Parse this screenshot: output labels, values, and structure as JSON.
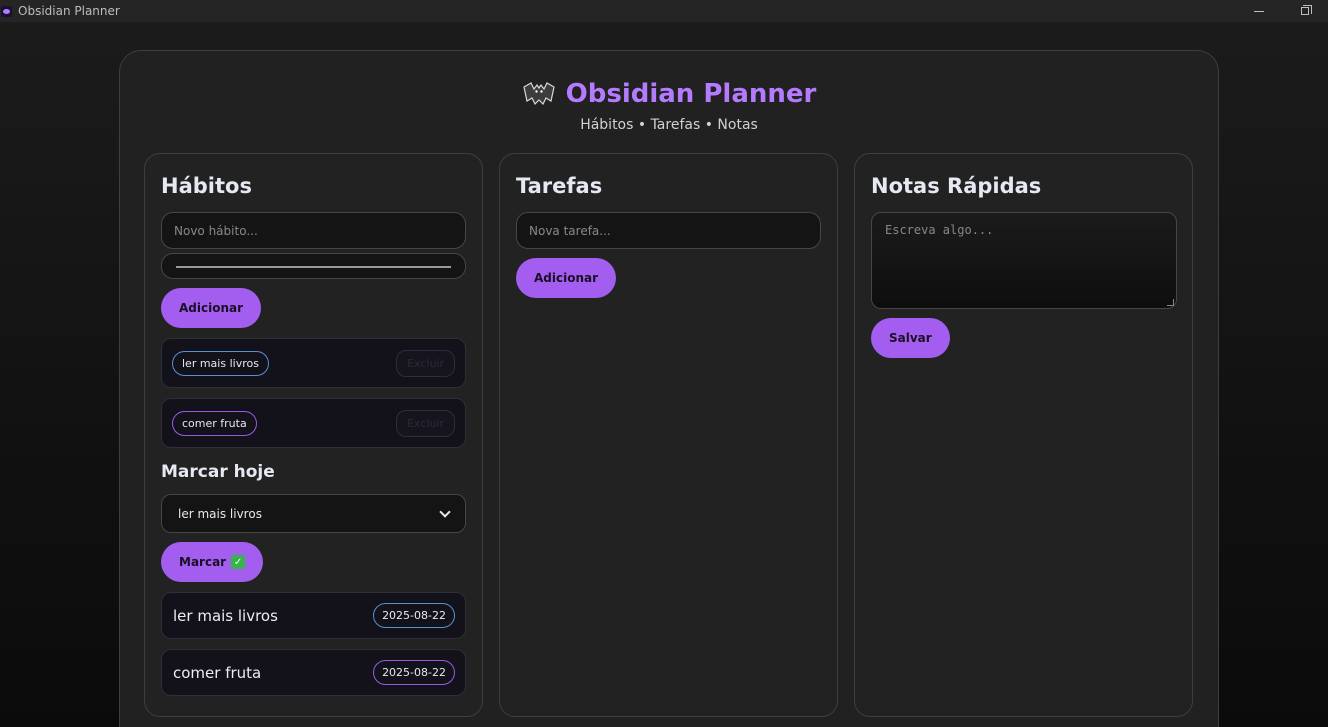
{
  "window": {
    "title": "Obsidian Planner"
  },
  "header": {
    "title": "Obsidian Planner",
    "subtitle": "Hábitos • Tarefas • Notas"
  },
  "habits": {
    "heading": "Hábitos",
    "input_placeholder": "Novo hábito...",
    "add_label": "Adicionar",
    "items": [
      {
        "label": "ler mais livros",
        "delete_label": "Excluir",
        "color": "#5a8fd0"
      },
      {
        "label": "comer fruta",
        "delete_label": "Excluir",
        "color": "#9b59e8"
      }
    ],
    "mark_heading": "Marcar hoje",
    "selected": "ler mais livros",
    "mark_label": "Marcar",
    "log": [
      {
        "name": "ler mais livros",
        "date": "2025-08-22"
      },
      {
        "name": "comer fruta",
        "date": "2025-08-22"
      }
    ]
  },
  "tasks": {
    "heading": "Tarefas",
    "input_placeholder": "Nova tarefa...",
    "add_label": "Adicionar"
  },
  "notes": {
    "heading": "Notas Rápidas",
    "textarea_placeholder": "Escreva algo...",
    "save_label": "Salvar"
  },
  "colors": {
    "accent": "#a35ef0",
    "title": "#b57bff"
  }
}
